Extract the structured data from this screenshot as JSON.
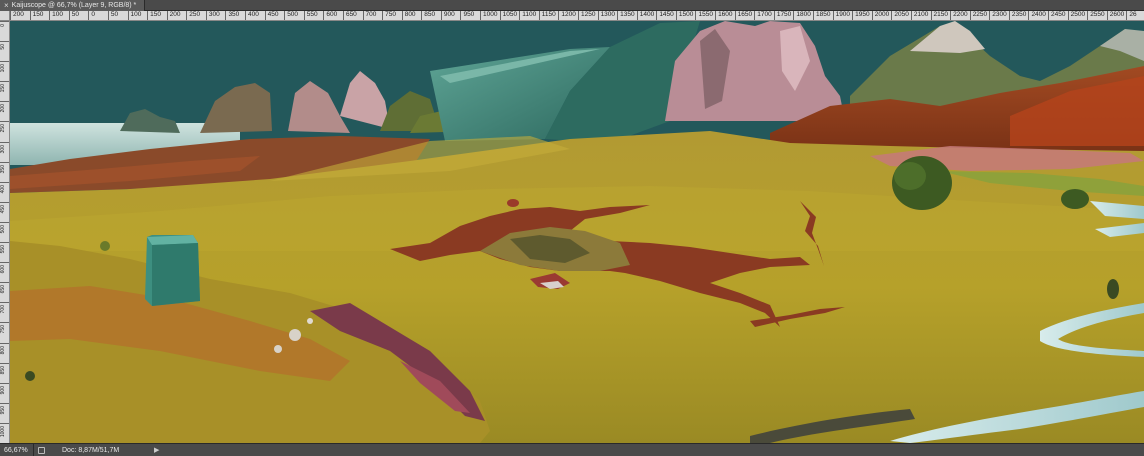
{
  "document_tab": {
    "close_glyph": "×",
    "title": "Kaijuscope @ 66,7% (Layer 9, RGB/8) *"
  },
  "ruler": {
    "horizontal_labels": [
      "200",
      "150",
      "100",
      "50",
      "0",
      "50",
      "100",
      "150",
      "200",
      "250",
      "300",
      "350",
      "400",
      "450",
      "500",
      "550",
      "600",
      "650",
      "700",
      "750",
      "800",
      "850",
      "900",
      "950",
      "1000",
      "1050",
      "1100",
      "1150",
      "1200",
      "1250",
      "1300",
      "1350",
      "1400",
      "1450",
      "1500",
      "1550",
      "1600",
      "1650",
      "1700",
      "1750",
      "1800",
      "1850",
      "1900",
      "1950",
      "2000",
      "2050",
      "2100",
      "2150",
      "2200",
      "2250",
      "2300",
      "2350",
      "2400",
      "2450",
      "2500",
      "2550",
      "2600",
      "26"
    ],
    "vertical_labels": [
      "0",
      "50",
      "100",
      "150",
      "200",
      "250",
      "300",
      "350",
      "400",
      "450",
      "500",
      "550",
      "600",
      "650",
      "700",
      "750",
      "800",
      "850",
      "900",
      "950",
      "1000"
    ]
  },
  "status": {
    "zoom": "66,67%",
    "doc_info": "Doc: 8,87M/51,7M",
    "arrow_glyph": "▶"
  },
  "icons": {
    "tab_close": "close-icon",
    "status_doc": "document-icon",
    "status_arrow": "play-arrow-icon"
  },
  "colors": {
    "sky": "#23585b",
    "grass": "#b9a42d",
    "panel": "#4a4a4a",
    "ruler": "#d9d9d9"
  }
}
